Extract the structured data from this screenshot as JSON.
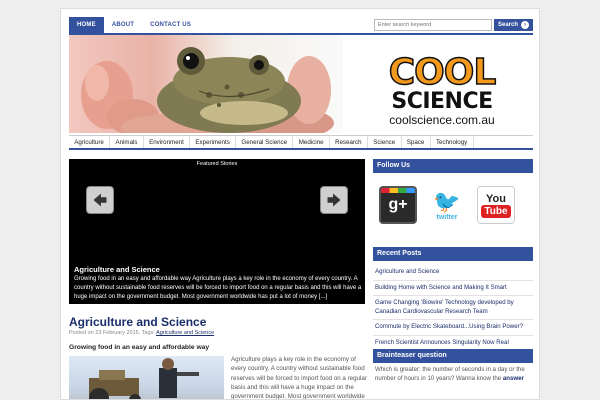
{
  "top_nav": [
    {
      "label": "HOME",
      "active": true
    },
    {
      "label": "ABOUT",
      "active": false
    },
    {
      "label": "CONTACT US",
      "active": false
    }
  ],
  "search": {
    "placeholder": "Enter search keyword",
    "button_label": "Search"
  },
  "logo": {
    "line1": "COOL",
    "line2": "SCIENCE",
    "url": "coolscience.com.au"
  },
  "categories": [
    "Agriculture",
    "Animals",
    "Environment",
    "Experiments",
    "General Science",
    "Medicine",
    "Research",
    "Science",
    "Space",
    "Technology"
  ],
  "slider": {
    "caption": "Featured Stories",
    "title": "Agriculture and Science",
    "text": "Growing food in an easy and affordable way Agriculture plays a key role in the economy of every country. A country without sustainable food reserves will be forced to import food on a regular basis and this will have a huge impact on the government budget. Most government worldwide has put a lot of money [...]"
  },
  "post": {
    "title": "Agriculture and Science",
    "meta_prefix": "Posted on 23 February 2015. Tags:",
    "meta_tag": "Agriculture and Science",
    "subtitle": "Growing food in an easy and affordable way",
    "text": "Agriculture plays a key role in the economy of every country. A country without sustainable food reserves will be forced to import food on a regular basis and this will have a huge impact on the government budget. Most government worldwide"
  },
  "sidebar": {
    "follow_title": "Follow Us",
    "social": [
      {
        "name": "Google+",
        "icon": "google-plus-icon"
      },
      {
        "name": "twitter",
        "icon": "twitter-icon"
      },
      {
        "name": "YouTube",
        "icon": "youtube-icon",
        "you": "You",
        "tube": "Tube"
      }
    ],
    "recent_title": "Recent Posts",
    "recent": [
      "Agriculture and Science",
      "Building Home with Science and Making It Smart",
      "Game Changing 'Biowire' Technology developed by Canadian Cardiovascular Research Team",
      "Commute by Electric Skateboard...Using Brain Power?",
      "French Scientist Announces Singularity Now Real"
    ],
    "teaser_title": "Brainteaser question",
    "teaser_text": "Which is greater: the number of seconds in a day or the number of hours in 10 years? Wanna know the",
    "teaser_link": "answer"
  },
  "colors": {
    "brand": "#34519d",
    "link": "#1a2e6b"
  }
}
